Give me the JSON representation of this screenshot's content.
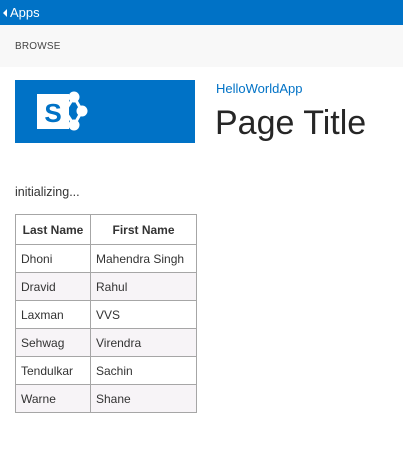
{
  "topbar": {
    "back_label": "Apps"
  },
  "ribbon": {
    "browse_label": "BROWSE"
  },
  "site": {
    "title": "HelloWorldApp",
    "page_title": "Page Title",
    "logo_letter": "S"
  },
  "status": {
    "text": "initializing..."
  },
  "table": {
    "headers": [
      "Last Name",
      "First Name"
    ],
    "rows": [
      [
        "Dhoni",
        "Mahendra Singh"
      ],
      [
        "Dravid",
        "Rahul"
      ],
      [
        "Laxman",
        "VVS"
      ],
      [
        "Sehwag",
        "Virendra"
      ],
      [
        "Tendulkar",
        "Sachin"
      ],
      [
        "Warne",
        "Shane"
      ]
    ]
  },
  "colors": {
    "suite_bar": "#0072c6",
    "logo_bg": "#0072c6",
    "link": "#0072c6",
    "ribbon_bg": "#f8f8f8",
    "row_alt": "#f7f4f7"
  },
  "icons": {
    "back": "caret-left-icon",
    "logo": "sharepoint-logo-icon"
  }
}
